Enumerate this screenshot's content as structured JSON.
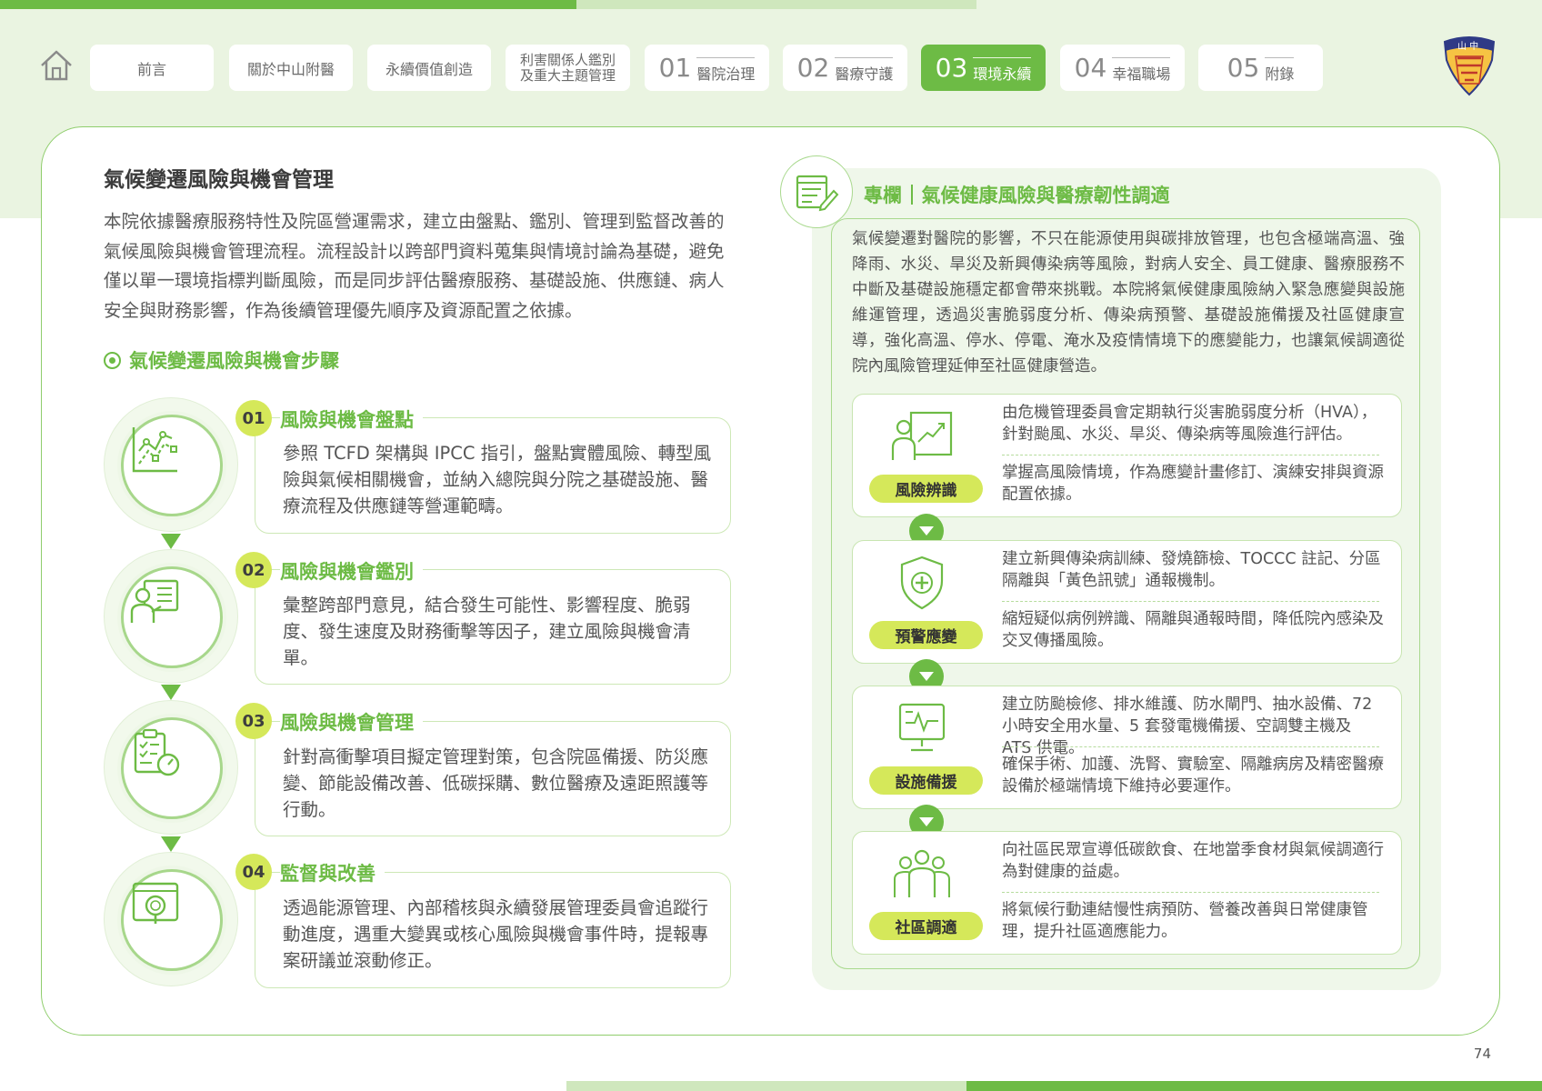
{
  "nav": {
    "tabs": [
      {
        "label": "前言"
      },
      {
        "label": "關於中山附醫"
      },
      {
        "label": "永續價值創造"
      },
      {
        "label_line1": "利害關係人鑑別",
        "label_line2": "及重大主題管理"
      },
      {
        "num": "01",
        "label": "醫院治理"
      },
      {
        "num": "02",
        "label": "醫療守護"
      },
      {
        "num": "03",
        "label": "環境永續"
      },
      {
        "num": "04",
        "label": "幸福職場"
      },
      {
        "num": "05",
        "label": "附錄"
      }
    ],
    "active_index": 6,
    "logo_text": "山 中 醫"
  },
  "section": {
    "title": "氣候變遷風險與機會管理",
    "intro": "本院依據醫療服務特性及院區營運需求，建立由盤點、鑑別、管理到監督改善的氣候風險與機會管理流程。流程設計以跨部門資料蒐集與情境討論為基礎，避免僅以單一環境指標判斷風險，而是同步評估醫療服務、基礎設施、供應鏈、病人安全與財務影響，作為後續管理優先順序及資源配置之依據。",
    "steps_heading": "氣候變遷風險與機會步驟"
  },
  "steps": [
    {
      "num": "01",
      "title": "風險與機會盤點",
      "text": "參照 TCFD 架構與 IPCC 指引，盤點實體風險、轉型風險與氣候相關機會，並納入總院與分院之基礎設施、醫療流程及供應鏈等營運範疇。",
      "icon": "line-chart-icon"
    },
    {
      "num": "02",
      "title": "風險與機會鑑別",
      "text": "彙整跨部門意見，結合發生可能性、影響程度、脆弱度、發生速度及財務衝擊等因子，建立風險與機會清單。",
      "icon": "presenter-board-icon"
    },
    {
      "num": "03",
      "title": "風險與機會管理",
      "text": "針對高衝擊項目擬定管理對策，包含院區備援、防災應變、節能設備改善、低碳採購、數位醫療及遠距照護等行動。",
      "icon": "checklist-gauge-icon"
    },
    {
      "num": "04",
      "title": "監督與改善",
      "text": "透過能源管理、內部稽核與永續發展管理委員會追蹤行動進度，遇重大變異或核心風險與機會事件時，提報專案研議並滾動修正。",
      "icon": "monitor-search-icon"
    }
  ],
  "column": {
    "label": "專欄",
    "title": "氣候健康風險與醫療韌性調適",
    "intro": "氣候變遷對醫院的影響，不只在能源使用與碳排放管理，也包含極端高溫、強降雨、水災、旱災及新興傳染病等風險，對病人安全、員工健康、醫療服務不中斷及基礎設施穩定都會帶來挑戰。本院將氣候健康風險納入緊急應變與設施維運管理，透過災害脆弱度分析、傳染病預警、基礎設施備援及社區健康宣導，強化高溫、停水、停電、淹水及疫情情境下的應變能力，也讓氣候調適從院內風險管理延伸至社區健康營造。",
    "categories": [
      {
        "pill": "風險辨識",
        "text1": "由危機管理委員會定期執行災害脆弱度分析（HVA），針對颱風、水災、旱災、傳染病等風險進行評估。",
        "text2": "掌握高風險情境，作為應變計畫修訂、演練安排與資源配置依據。",
        "icon": "analyst-chart-icon"
      },
      {
        "pill": "預警應變",
        "text1": "建立新興傳染病訓練、發燒篩檢、TOCCC 註記、分區隔離與「黃色訊號」通報機制。",
        "text2": "縮短疑似病例辨識、隔離與通報時間，降低院內感染及交叉傳播風險。",
        "icon": "medical-shield-icon"
      },
      {
        "pill": "設施備援",
        "text1": "建立防颱檢修、排水維護、防水閘門、抽水設備、72 小時安全用水量、5 套發電機備援、空調雙主機及 ATS 供電。",
        "text2": "確保手術、加護、洗腎、實驗室、隔離病房及精密醫療設備於極端情境下維持必要運作。",
        "icon": "monitor-heartbeat-icon"
      },
      {
        "pill": "社區調適",
        "text1": "向社區民眾宣導低碳飲食、在地當季食材與氣候調適行為對健康的益處。",
        "text2": "將氣候行動連結慢性病預防、營養改善與日常健康管理，提升社區適應能力。",
        "icon": "community-people-icon"
      }
    ]
  },
  "page_number": "74",
  "colors": {
    "accent_green": "#6dbb45",
    "accent_lime": "#d5e85a",
    "light_green_bg": "#eaf4e1"
  }
}
